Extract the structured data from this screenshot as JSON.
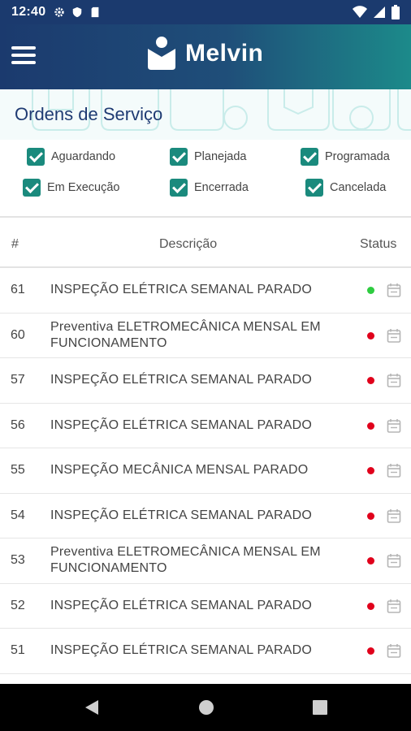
{
  "status_bar": {
    "time": "12:40",
    "left_icons": [
      "gear-icon",
      "shield-icon",
      "sd-card-icon"
    ],
    "right_icons": [
      "wifi-icon",
      "signal-icon",
      "battery-icon"
    ]
  },
  "app_bar": {
    "brand": "Melvin",
    "menu_icon": "hamburger-menu-icon"
  },
  "page": {
    "title": "Ordens de Serviço"
  },
  "filters": [
    {
      "label": "Aguardando",
      "checked": true
    },
    {
      "label": "Planejada",
      "checked": true
    },
    {
      "label": "Programada",
      "checked": true
    },
    {
      "label": "Em Execução",
      "checked": true
    },
    {
      "label": "Encerrada",
      "checked": true
    },
    {
      "label": "Cancelada",
      "checked": true
    }
  ],
  "table": {
    "headers": {
      "number": "#",
      "description": "Descrição",
      "status": "Status"
    },
    "rows": [
      {
        "number": "61",
        "description": "INSPEÇÃO ELÉTRICA SEMANAL PARADO",
        "status_color": "#2ecc40"
      },
      {
        "number": "60",
        "description": "Preventiva ELETROMECÂNICA MENSAL EM FUNCIONAMENTO",
        "status_color": "#e0001b"
      },
      {
        "number": "57",
        "description": "INSPEÇÃO ELÉTRICA SEMANAL PARADO",
        "status_color": "#e0001b"
      },
      {
        "number": "56",
        "description": "INSPEÇÃO ELÉTRICA SEMANAL PARADO",
        "status_color": "#e0001b"
      },
      {
        "number": "55",
        "description": "INSPEÇÃO MECÂNICA MENSAL PARADO",
        "status_color": "#e0001b"
      },
      {
        "number": "54",
        "description": "INSPEÇÃO ELÉTRICA SEMANAL PARADO",
        "status_color": "#e0001b"
      },
      {
        "number": "53",
        "description": "Preventiva ELETROMECÂNICA MENSAL EM FUNCIONAMENTO",
        "status_color": "#e0001b"
      },
      {
        "number": "52",
        "description": "INSPEÇÃO ELÉTRICA SEMANAL PARADO",
        "status_color": "#e0001b"
      },
      {
        "number": "51",
        "description": "INSPEÇÃO ELÉTRICA SEMANAL PARADO",
        "status_color": "#e0001b"
      }
    ]
  },
  "nav_bar": {
    "buttons": [
      "back-icon",
      "home-icon",
      "recents-icon"
    ]
  },
  "colors": {
    "primary": "#1b3a6e",
    "accent": "#1a8a7d",
    "status_ok": "#2ecc40",
    "status_pending": "#e0001b"
  }
}
